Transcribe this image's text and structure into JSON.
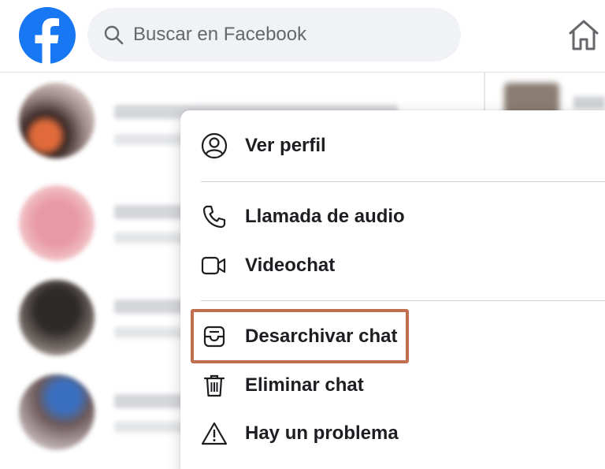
{
  "header": {
    "logo_icon": "facebook-logo",
    "search": {
      "placeholder": "Buscar en Facebook",
      "icon": "search-icon"
    },
    "home_icon": "home-icon",
    "brand_color": "#1877f2"
  },
  "context_menu": {
    "items": [
      {
        "label": "Ver perfil",
        "icon": "user-circle-icon"
      },
      {
        "label": "Llamada de audio",
        "icon": "phone-icon"
      },
      {
        "label": "Videochat",
        "icon": "video-camera-icon"
      },
      {
        "label": "Desarchivar chat",
        "icon": "unarchive-icon",
        "highlighted": true
      },
      {
        "label": "Eliminar chat",
        "icon": "trash-icon"
      },
      {
        "label": "Hay un problema",
        "icon": "warning-icon"
      }
    ],
    "highlight_color": "#c0704e"
  }
}
